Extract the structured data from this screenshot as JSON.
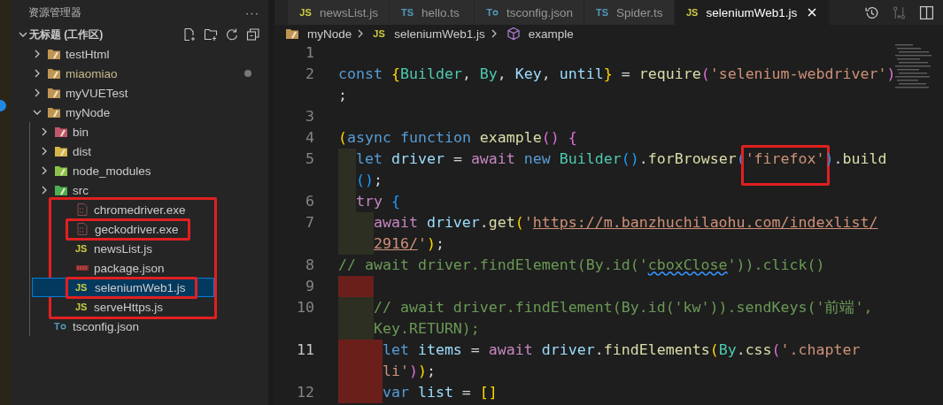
{
  "sidebar": {
    "title": "资源管理器",
    "more": "···",
    "tree": [
      {
        "label": "无标题 (工作区)",
        "kind": "workspace",
        "expanded": true,
        "selected": false,
        "modified": false,
        "children": [
          {
            "label": "testHtml",
            "kind": "folder",
            "expanded": false,
            "selected": false,
            "modified": false
          },
          {
            "label": "miaomiao",
            "kind": "folder",
            "expanded": false,
            "selected": false,
            "modified": true
          },
          {
            "label": "myVUETest",
            "kind": "folder",
            "expanded": false,
            "selected": false,
            "modified": false
          },
          {
            "label": "myNode",
            "kind": "folder",
            "expanded": true,
            "selected": false,
            "modified": false,
            "children": [
              {
                "label": "bin",
                "kind": "bin-folder",
                "expanded": false,
                "selected": false,
                "modified": false
              },
              {
                "label": "dist",
                "kind": "dist-folder",
                "expanded": false,
                "selected": false,
                "modified": false
              },
              {
                "label": "node_modules",
                "kind": "node-folder",
                "expanded": false,
                "selected": false,
                "modified": false
              },
              {
                "label": "src",
                "kind": "src-folder",
                "expanded": false,
                "selected": false,
                "modified": false
              },
              {
                "label": "chromedriver.exe",
                "kind": "exe",
                "selected": false,
                "modified": false,
                "framed": true,
                "boxed": false
              },
              {
                "label": "geckodriver.exe",
                "kind": "exe",
                "selected": false,
                "modified": false,
                "framed": true,
                "boxed": true
              },
              {
                "label": "newsList.js",
                "kind": "js",
                "badge": "JS",
                "selected": false,
                "modified": false,
                "framed": true,
                "boxed": false
              },
              {
                "label": "package.json",
                "kind": "npm",
                "selected": false,
                "modified": false,
                "framed": true,
                "boxed": false
              },
              {
                "label": "seleniumWeb1.js",
                "kind": "js",
                "badge": "JS",
                "selected": true,
                "modified": false,
                "framed": true,
                "boxed": true
              },
              {
                "label": "serveHttps.js",
                "kind": "js",
                "badge": "JS",
                "selected": false,
                "modified": false,
                "framed": true,
                "boxed": false
              },
              {
                "label": "tsconfig.json",
                "kind": "tsconfig",
                "badge": "T",
                "selected": false,
                "modified": false,
                "framed": false,
                "boxed": false
              }
            ]
          }
        ]
      }
    ]
  },
  "tabs": [
    {
      "label": "newsList.js",
      "kind": "js",
      "badge": "JS",
      "selected": false
    },
    {
      "label": "hello.ts",
      "kind": "ts",
      "badge": "TS",
      "selected": false
    },
    {
      "label": "tsconfig.json",
      "kind": "tsconfig",
      "badge": "T",
      "selected": false
    },
    {
      "label": "Spider.ts",
      "kind": "ts",
      "badge": "TS",
      "selected": false
    },
    {
      "label": "seleniumWeb1.js",
      "kind": "js",
      "badge": "JS",
      "selected": true
    }
  ],
  "breadcrumb": [
    {
      "label": "myNode",
      "kind": "folder"
    },
    {
      "label": "seleniumWeb1.js",
      "kind": "js",
      "badge": "JS"
    },
    {
      "label": "example",
      "kind": "symbol"
    }
  ],
  "code": [
    {
      "number": "1",
      "kind": "flush"
    },
    {
      "number": "2",
      "kind": "flush",
      "rows": [
        {
          "tokens": [
            {
              "kind": "kw",
              "text": "const"
            },
            {
              "kind": "b1",
              "text": " {"
            },
            {
              "kind": "cls",
              "text": "Builder"
            },
            {
              "kind": "punct",
              "text": ", "
            },
            {
              "kind": "cls",
              "text": "By"
            },
            {
              "kind": "punct",
              "text": ", "
            },
            {
              "kind": "var",
              "text": "Key"
            },
            {
              "kind": "punct",
              "text": ", "
            },
            {
              "kind": "var",
              "text": "until"
            },
            {
              "kind": "b1",
              "text": "}"
            },
            {
              "kind": "punct",
              "text": " = "
            },
            {
              "kind": "fn",
              "text": "require"
            },
            {
              "kind": "b2",
              "text": "("
            },
            {
              "kind": "str",
              "text": "'selenium-webdriver'"
            },
            {
              "kind": "b2",
              "text": ")"
            }
          ]
        },
        {
          "tokens": [
            {
              "kind": "punct",
              "text": ";"
            }
          ]
        }
      ]
    },
    {
      "number": "3",
      "kind": "flush"
    },
    {
      "number": "4",
      "kind": "flush",
      "rows": [
        {
          "tokens": [
            {
              "kind": "b1",
              "text": "("
            },
            {
              "kind": "kw",
              "text": "async"
            },
            {
              "kind": "kw",
              "text": " function"
            },
            {
              "kind": "fn",
              "text": " example"
            },
            {
              "kind": "b2",
              "text": "()"
            },
            {
              "kind": "b2",
              "text": " {"
            }
          ]
        }
      ]
    },
    {
      "number": "5",
      "kind": "shallow",
      "indent_error": false,
      "rows": [
        {
          "tokens": [
            {
              "kind": "kw",
              "text": "let"
            },
            {
              "kind": "var",
              "text": " driver"
            },
            {
              "kind": "punct",
              "text": " = "
            },
            {
              "kind": "ctl",
              "text": "await"
            },
            {
              "kind": "kw",
              "text": " new"
            },
            {
              "kind": "cls",
              "text": " Builder"
            },
            {
              "kind": "b3",
              "text": "()"
            },
            {
              "kind": "punct",
              "text": "."
            },
            {
              "kind": "fn",
              "text": "forBrowser"
            },
            {
              "kind": "b3",
              "text": "("
            },
            {
              "kind": "str",
              "text": "'firefox'",
              "boxed": true
            },
            {
              "kind": "b3",
              "text": ")"
            },
            {
              "kind": "punct",
              "text": "."
            },
            {
              "kind": "fn",
              "text": "build"
            }
          ]
        },
        {
          "tokens": [
            {
              "kind": "b3",
              "text": "()"
            },
            {
              "kind": "punct",
              "text": ";"
            }
          ]
        }
      ]
    },
    {
      "number": "6",
      "kind": "shallow",
      "indent_error": false,
      "rows": [
        {
          "tokens": [
            {
              "kind": "ctl",
              "text": "try"
            },
            {
              "kind": "b3",
              "text": " {"
            }
          ]
        }
      ]
    },
    {
      "number": "7",
      "kind": "deep",
      "indent_error": false,
      "rows": [
        {
          "tokens": [
            {
              "kind": "ctl",
              "text": "await"
            },
            {
              "kind": "var",
              "text": " driver"
            },
            {
              "kind": "punct",
              "text": "."
            },
            {
              "kind": "fn",
              "text": "get"
            },
            {
              "kind": "b1",
              "text": "("
            },
            {
              "kind": "str",
              "text": "'"
            },
            {
              "kind": "link",
              "text": "https://m.banzhuchilaohu.com/indexlist/"
            }
          ]
        },
        {
          "tokens": [
            {
              "kind": "link",
              "text": "2916/"
            },
            {
              "kind": "str",
              "text": "'"
            },
            {
              "kind": "b1",
              "text": ")"
            },
            {
              "kind": "punct",
              "text": ";"
            }
          ]
        }
      ]
    },
    {
      "number": "8",
      "kind": "flush",
      "rows": [
        {
          "tokens": [
            {
              "kind": "cmt",
              "text": "// await driver.findElement(By.id('"
            },
            {
              "kind": "cmt_warn",
              "text": "cboxClose"
            },
            {
              "kind": "cmt",
              "text": "')).click()"
            }
          ]
        }
      ]
    },
    {
      "number": "9",
      "kind": "deep",
      "indent_error": true
    },
    {
      "number": "10",
      "kind": "deep",
      "indent_error": false,
      "rows": [
        {
          "tokens": [
            {
              "kind": "cmt",
              "text": "// await driver.findElement(By.id('kw')).sendKeys('前端',"
            }
          ]
        },
        {
          "tokens": [
            {
              "kind": "cmt",
              "text": "Key.RETURN);"
            }
          ]
        }
      ]
    },
    {
      "number": "11",
      "kind": "deeper",
      "indent_error": true,
      "rows": [
        {
          "tokens": [
            {
              "kind": "kw",
              "text": "let"
            },
            {
              "kind": "var",
              "text": " items"
            },
            {
              "kind": "punct",
              "text": " = "
            },
            {
              "kind": "ctl",
              "text": "await"
            },
            {
              "kind": "var",
              "text": " driver"
            },
            {
              "kind": "punct",
              "text": "."
            },
            {
              "kind": "fn",
              "text": "findElements"
            },
            {
              "kind": "b1",
              "text": "("
            },
            {
              "kind": "cls",
              "text": "By"
            },
            {
              "kind": "punct",
              "text": "."
            },
            {
              "kind": "fn",
              "text": "css"
            },
            {
              "kind": "b2",
              "text": "("
            },
            {
              "kind": "str",
              "text": "'.chapter"
            }
          ]
        },
        {
          "tokens": [
            {
              "kind": "str",
              "text": "li'"
            },
            {
              "kind": "b2",
              "text": ")"
            },
            {
              "kind": "b1",
              "text": ")"
            },
            {
              "kind": "punct",
              "text": ";"
            }
          ]
        }
      ]
    },
    {
      "number": "12",
      "kind": "deeper",
      "indent_error": true,
      "rows": [
        {
          "tokens": [
            {
              "kind": "kw",
              "text": "var"
            },
            {
              "kind": "var",
              "text": " list"
            },
            {
              "kind": "punct",
              "text": " = "
            },
            {
              "kind": "b1",
              "text": "[]"
            }
          ]
        }
      ]
    }
  ]
}
